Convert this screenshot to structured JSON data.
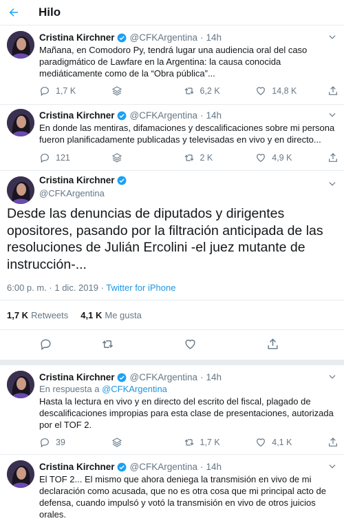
{
  "header": {
    "title": "Hilo"
  },
  "tweets": [
    {
      "name": "Cristina Kirchner",
      "handle": "@CFKArgentina",
      "time": "14h",
      "text": "Mañana, en Comodoro Py, tendrá lugar una audiencia oral del caso paradigmático de Lawfare en la Argentina: la causa conocida mediáticamente como de la “Obra pública”...",
      "replies": "1,7 K",
      "retweets": "6,2 K",
      "likes": "14,8 K"
    },
    {
      "name": "Cristina Kirchner",
      "handle": "@CFKArgentina",
      "time": "14h",
      "text": "En donde las mentiras, difamaciones y descalificaciones sobre mi persona fueron planificadamente publicadas y televisadas en vivo y en directo...",
      "replies": "121",
      "retweets": "2 K",
      "likes": "4,9 K"
    }
  ],
  "main": {
    "name": "Cristina Kirchner",
    "handle": "@CFKArgentina",
    "text": "Desde las denuncias de diputados y dirigentes opositores, pasando por la filtración anticipada de las resoluciones de Julián Ercolini -el juez mutante de instrucción-...",
    "datetime": "6:00 p. m. · 1 dic. 2019 · ",
    "source": "Twitter for iPhone",
    "retweets_count": "1,7 K",
    "retweets_label": "Retweets",
    "likes_count": "4,1 K",
    "likes_label": "Me gusta"
  },
  "replies": [
    {
      "name": "Cristina Kirchner",
      "handle": "@CFKArgentina",
      "time": "14h",
      "reply_prefix": "En respuesta a ",
      "reply_to": "@CFKArgentina",
      "text": "Hasta la lectura en vivo y en directo del escrito del fiscal, plagado de descalificaciones impropias para esta clase de presentaciones, autorizada por el TOF 2.",
      "replies": "39",
      "retweets": "1,7 K",
      "likes": "4,1 K"
    },
    {
      "name": "Cristina Kirchner",
      "handle": "@CFKArgentina",
      "time": "14h",
      "text": "El TOF 2... El mismo que ahora deniega la transmisión en vivo de mi declaración como acusada, que no es otra cosa que mi principal acto de defensa, cuando impulsó y votó la transmisión en vivo de otros juicios orales."
    }
  ],
  "colors": {
    "accent": "#1da1f2",
    "link": "#1b95e0",
    "muted": "#657786",
    "border": "#e6ecf0"
  },
  "icons": [
    "back-arrow-icon",
    "verified-icon",
    "chevron-down-icon",
    "reply-icon",
    "layers-icon",
    "retweet-icon",
    "like-icon",
    "share-icon"
  ]
}
